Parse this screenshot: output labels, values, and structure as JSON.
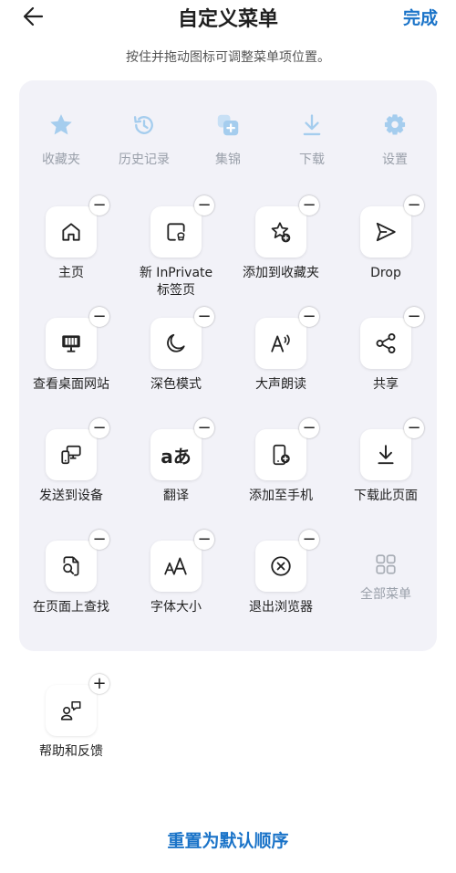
{
  "header": {
    "title": "自定义菜单",
    "done_label": "完成"
  },
  "hint": "按住并拖动图标可调整菜单项位置。",
  "toolbar": [
    {
      "label": "收藏夹",
      "icon": "star-icon"
    },
    {
      "label": "历史记录",
      "icon": "history-icon"
    },
    {
      "label": "集锦",
      "icon": "collections-icon"
    },
    {
      "label": "下载",
      "icon": "download-icon"
    },
    {
      "label": "设置",
      "icon": "gear-icon"
    }
  ],
  "grid": [
    {
      "label": "主页",
      "icon": "home-icon",
      "action": "−"
    },
    {
      "label": "新 InPrivate\n标签页",
      "icon": "inprivate-tab-icon",
      "action": "−"
    },
    {
      "label": "添加到收藏夹",
      "icon": "add-favorite-icon",
      "action": "−"
    },
    {
      "label": "Drop",
      "icon": "send-icon",
      "action": "−"
    },
    {
      "label": "查看桌面网站",
      "icon": "desktop-icon",
      "action": "−"
    },
    {
      "label": "深色模式",
      "icon": "moon-icon",
      "action": "−"
    },
    {
      "label": "大声朗读",
      "icon": "read-aloud-icon",
      "action": "−"
    },
    {
      "label": "共享",
      "icon": "share-icon",
      "action": "−"
    },
    {
      "label": "发送到设备",
      "icon": "send-to-device-icon",
      "action": "−"
    },
    {
      "label": "翻译",
      "icon": "translate-icon",
      "action": "−"
    },
    {
      "label": "添加至手机",
      "icon": "add-to-phone-icon",
      "action": "−"
    },
    {
      "label": "下载此页面",
      "icon": "download-page-icon",
      "action": "−"
    },
    {
      "label": "在页面上查找",
      "icon": "find-in-page-icon",
      "action": "−"
    },
    {
      "label": "字体大小",
      "icon": "font-size-icon",
      "action": "−"
    },
    {
      "label": "退出浏览器",
      "icon": "exit-icon",
      "action": "−"
    }
  ],
  "all_menu": {
    "label": "全部菜单",
    "icon": "grid-icon"
  },
  "extra": [
    {
      "label": "帮助和反馈",
      "icon": "feedback-icon",
      "action": "+"
    }
  ],
  "reset_label": "重置为默认顺序",
  "colors": {
    "accent": "#1a73c8",
    "panel": "#f2f2f8",
    "disabled": "#9aa0aa",
    "disabled_icon": "#9ec9ee"
  }
}
